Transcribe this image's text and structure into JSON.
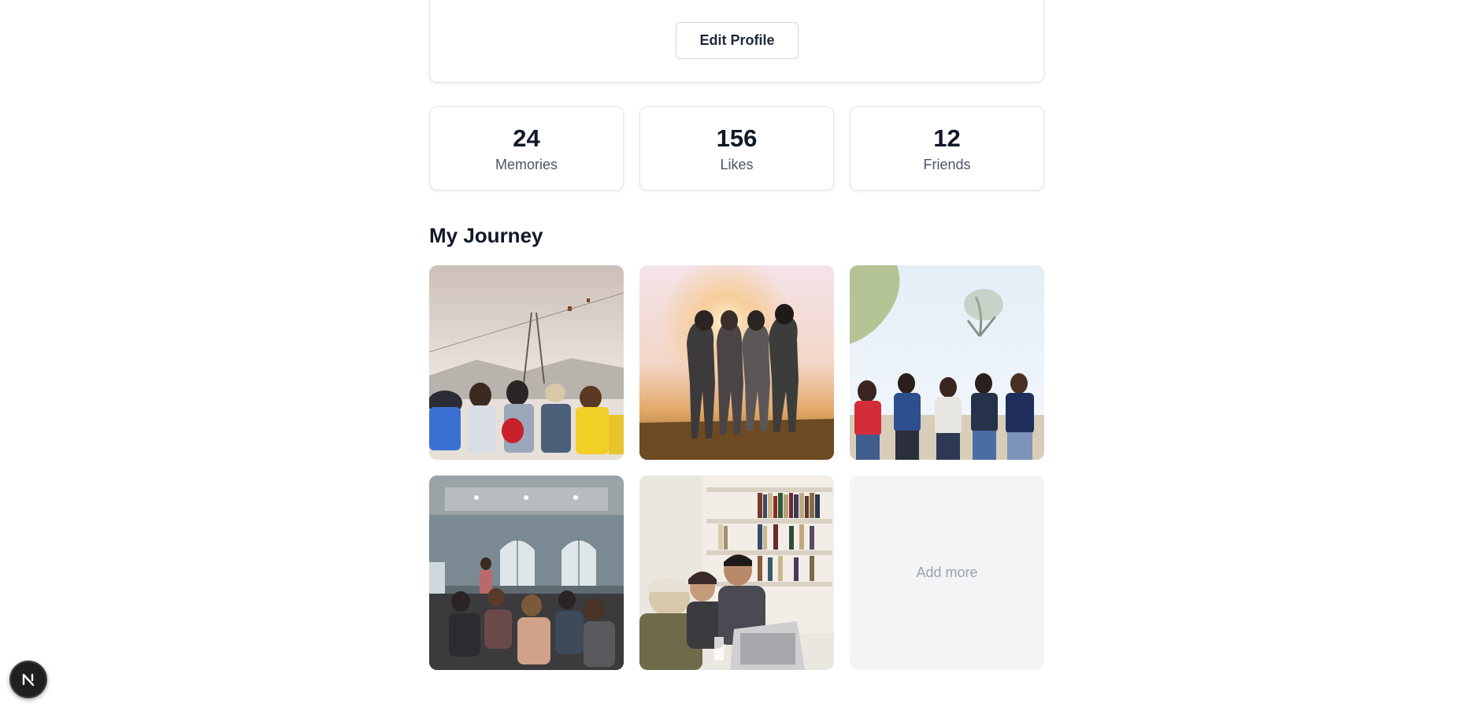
{
  "profile": {
    "edit_button_label": "Edit Profile"
  },
  "stats": [
    {
      "value": "24",
      "label": "Memories"
    },
    {
      "value": "156",
      "label": "Likes"
    },
    {
      "value": "12",
      "label": "Friends"
    }
  ],
  "journey": {
    "title": "My Journey",
    "add_more_label": "Add more"
  },
  "dev_badge": {
    "icon": "nextjs-logo-icon"
  }
}
